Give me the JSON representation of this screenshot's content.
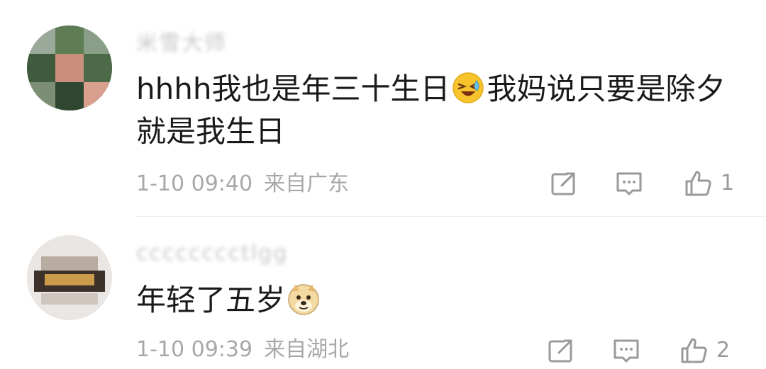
{
  "comments": [
    {
      "username": "米雪大师",
      "text_before": "hhhh我也是年三十生日",
      "emoji": "laughing-tears-emoji",
      "text_after": "我妈说只要是除夕就是我生日",
      "time": "1-10 09:40",
      "location": "来自广东",
      "likes": "1"
    },
    {
      "username": "cccccccctlgg",
      "text_before": "年轻了五岁",
      "emoji": "doge-emoji",
      "text_after": "",
      "time": "1-10 09:39",
      "location": "来自湖北",
      "likes": "2"
    }
  ],
  "icons": {
    "share": "share-icon",
    "reply": "comment-icon",
    "like": "thumbs-up-icon"
  },
  "colors": {
    "text": "#1a1a1a",
    "meta": "#a8a8a8",
    "icon": "#9a9a9a",
    "divider": "#ececec"
  }
}
